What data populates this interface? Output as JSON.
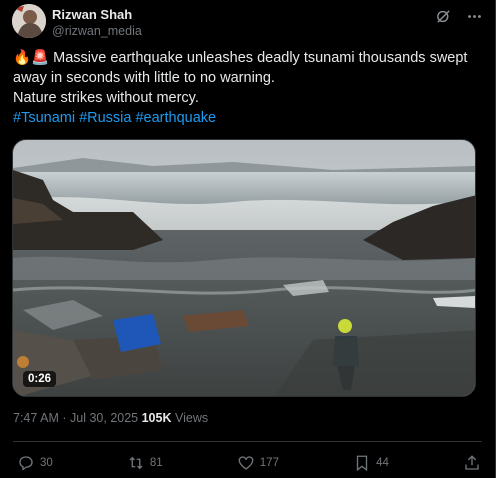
{
  "author": {
    "name": "Rizwan Shah",
    "handle": "@rizwan_media"
  },
  "header_icons": [
    "grok-icon",
    "more-icon"
  ],
  "post": {
    "line1": "🔥🚨 Massive earthquake unleashes deadly tsunami thousands swept",
    "line2": "away in seconds with little to no warning.",
    "line3": "Nature strikes without mercy.",
    "hashtags": [
      "#Tsunami",
      "#Russia",
      "#earthquake"
    ]
  },
  "video": {
    "duration": "0:26"
  },
  "meta": {
    "time": "7:47 AM",
    "separator": "·",
    "date": "Jul 30, 2025",
    "views_count": "105K",
    "views_label": "Views"
  },
  "actions": {
    "replies": "30",
    "reposts": "81",
    "likes": "177",
    "bookmarks": "44"
  },
  "colors": {
    "accent": "#1d9bf0",
    "muted": "#71767b",
    "text": "#e7e9ea",
    "background": "#000000"
  }
}
